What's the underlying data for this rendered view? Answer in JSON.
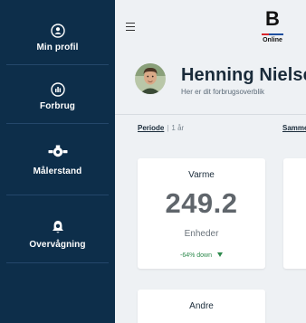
{
  "sidebar": {
    "items": [
      {
        "label": "Min profil",
        "icon": "user-circle-icon"
      },
      {
        "label": "Forbrug",
        "icon": "bar-chart-circle-icon"
      },
      {
        "label": "Målerstand",
        "icon": "meter-icon"
      },
      {
        "label": "Overvågning",
        "icon": "bell-icon"
      }
    ]
  },
  "header": {
    "logo_letter": "B",
    "logo_sub": "Online",
    "user_name": "Henning Nielsen",
    "subtitle": "Her er dit forbrugsoverblik"
  },
  "tabs": {
    "periode": "Periode",
    "periode_value": "1 år",
    "samm": "Sammenlign"
  },
  "cards": [
    {
      "title": "Varme",
      "value": "249.2",
      "unit": "Enheder",
      "trend": "-64% down"
    },
    {
      "title": "Andre"
    }
  ],
  "colors": {
    "sidebar_bg": "#0d2e4a",
    "trend_down": "#2e8a4d"
  }
}
